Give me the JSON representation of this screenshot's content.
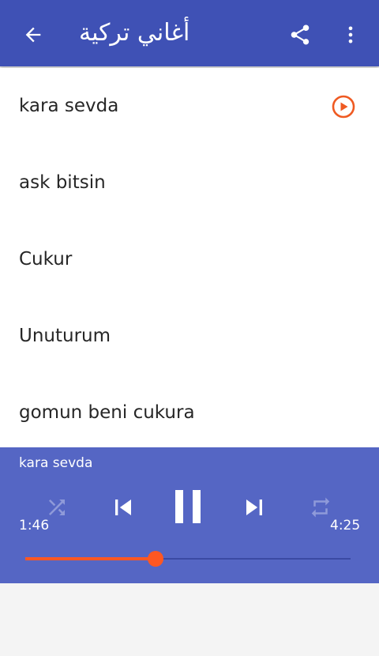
{
  "toolbar": {
    "title": "أغاني تركية",
    "back_icon": "arrow-left-icon",
    "share_icon": "share-icon",
    "more_icon": "more-vertical-icon",
    "color": "#3f51b5"
  },
  "songs": [
    {
      "title": "kara sevda",
      "playing": true
    },
    {
      "title": "ask bitsin",
      "playing": false
    },
    {
      "title": "Cukur",
      "playing": false
    },
    {
      "title": "Unuturum",
      "playing": false
    },
    {
      "title": "gomun beni cukura",
      "playing": false
    }
  ],
  "player": {
    "now_playing": "kara sevda",
    "elapsed": "1:46",
    "duration": "4:25",
    "progress": 0.4,
    "shuffle_enabled": false,
    "repeat_enabled": false,
    "state": "playing",
    "accent_color": "#ff5722",
    "background_color": "#5566c4"
  }
}
